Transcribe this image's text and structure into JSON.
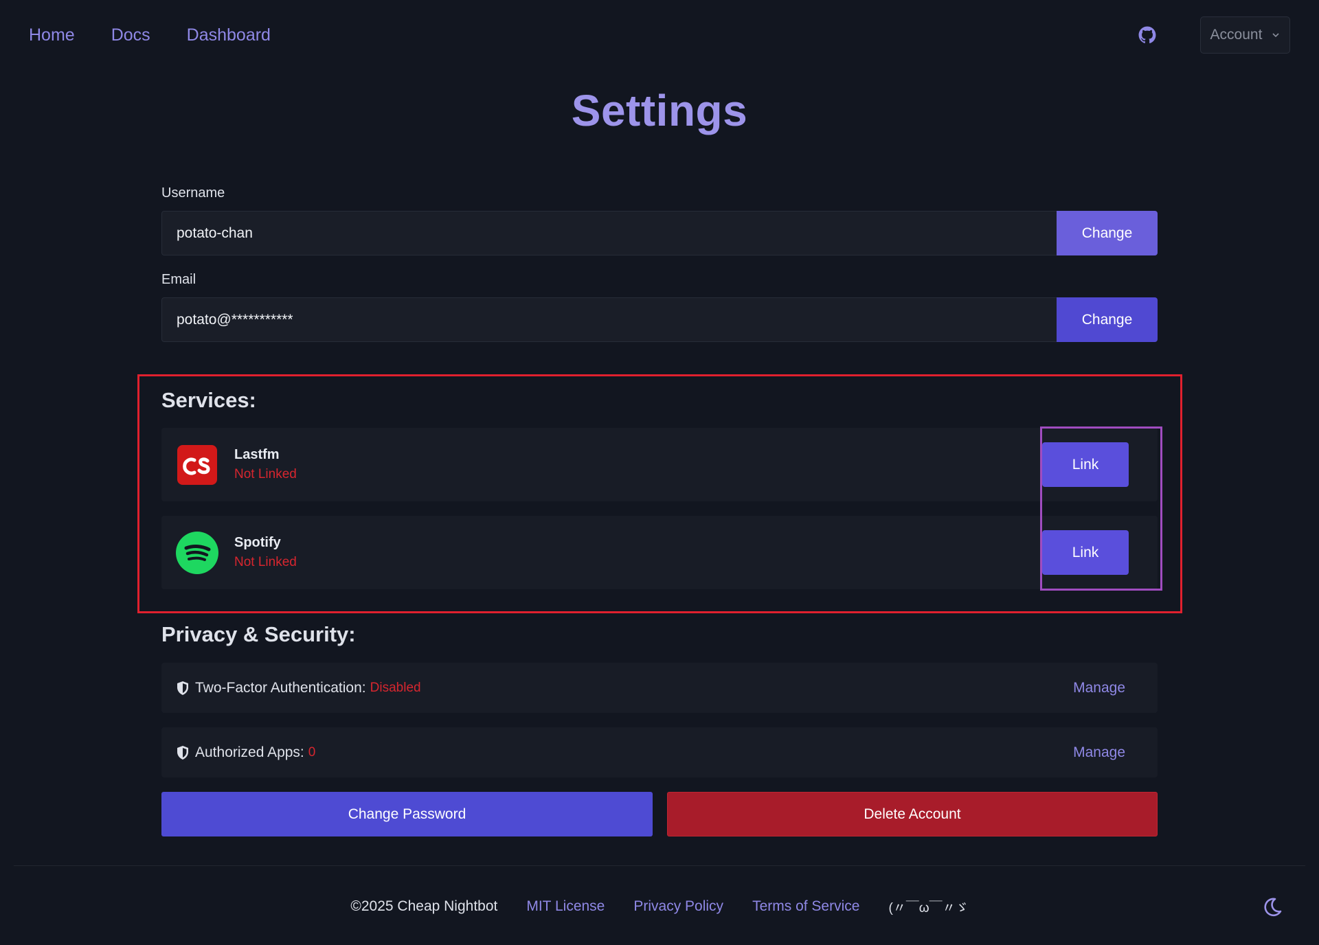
{
  "nav": {
    "links": [
      "Home",
      "Docs",
      "Dashboard"
    ],
    "account_label": "Account",
    "icons": [
      "github-icon",
      "chevron-down-icon"
    ]
  },
  "page": {
    "title": "Settings"
  },
  "fields": {
    "username": {
      "label": "Username",
      "value": "potato-chan",
      "button": "Change"
    },
    "email": {
      "label": "Email",
      "value": "potato@***********",
      "button": "Change"
    }
  },
  "services": {
    "title": "Services:",
    "items": [
      {
        "name": "Lastfm",
        "status": "Not Linked",
        "button": "Link",
        "icon": "lastfm-icon"
      },
      {
        "name": "Spotify",
        "status": "Not Linked",
        "button": "Link",
        "icon": "spotify-icon"
      }
    ]
  },
  "privacy": {
    "title": "Privacy & Security:",
    "items": [
      {
        "label": "Two-Factor Authentication:",
        "value": "Disabled",
        "action": "Manage"
      },
      {
        "label": "Authorized Apps:",
        "value": "0",
        "action": "Manage"
      }
    ],
    "change_password": "Change Password",
    "delete_account": "Delete Account"
  },
  "footer": {
    "copyright": "©2025 Cheap Nightbot",
    "links": [
      "MIT License",
      "Privacy Policy",
      "Terms of Service"
    ],
    "kaomoji": "(〃￣ω￣〃ゞ",
    "icons": [
      "moon-icon"
    ]
  },
  "colors": {
    "accent": "#8f88e6",
    "primary_button": "#5a4fdc",
    "danger": "#a81c2a",
    "status_red": "#d7262f",
    "background": "#121620",
    "card": "#181c26"
  }
}
